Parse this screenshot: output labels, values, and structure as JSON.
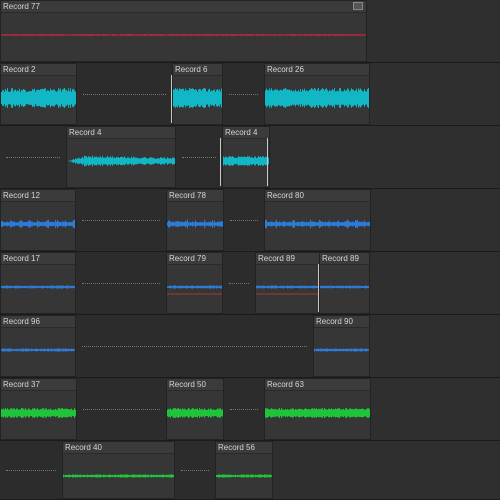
{
  "clips": {
    "record_77": {
      "label": "Record 77",
      "color": "#b02a3a"
    },
    "record_2": {
      "label": "Record 2",
      "color": "#12b7c6"
    },
    "record_6": {
      "label": "Record 6",
      "color": "#12b7c6"
    },
    "record_26": {
      "label": "Record 26",
      "color": "#12b7c6"
    },
    "record_4a": {
      "label": "Record 4",
      "color": "#12b7c6"
    },
    "record_4b": {
      "label": "Record 4",
      "color": "#12b7c6"
    },
    "record_12": {
      "label": "Record 12",
      "color": "#2d7bd6"
    },
    "record_78": {
      "label": "Record 78",
      "color": "#2d7bd6"
    },
    "record_80": {
      "label": "Record 80",
      "color": "#2d7bd6"
    },
    "record_17": {
      "label": "Record 17",
      "color": "#2d7bd6"
    },
    "record_79": {
      "label": "Record 79",
      "color": "#2d7bd6"
    },
    "record_89a": {
      "label": "Record 89",
      "color": "#2d7bd6"
    },
    "record_89b": {
      "label": "Record 89",
      "color": "#2d7bd6"
    },
    "record_96": {
      "label": "Record 96",
      "color": "#2d7bd6"
    },
    "record_90": {
      "label": "Record 90",
      "color": "#2d7bd6"
    },
    "record_37": {
      "label": "Record 37",
      "color": "#1fc43a"
    },
    "record_50": {
      "label": "Record 50",
      "color": "#1fc43a"
    },
    "record_63": {
      "label": "Record 63",
      "color": "#1fc43a"
    },
    "record_40": {
      "label": "Record 40",
      "color": "#1fc43a"
    },
    "record_56": {
      "label": "Record 56",
      "color": "#1fc43a"
    }
  },
  "icons": {
    "clip_menu": "clip-menu-icon"
  }
}
